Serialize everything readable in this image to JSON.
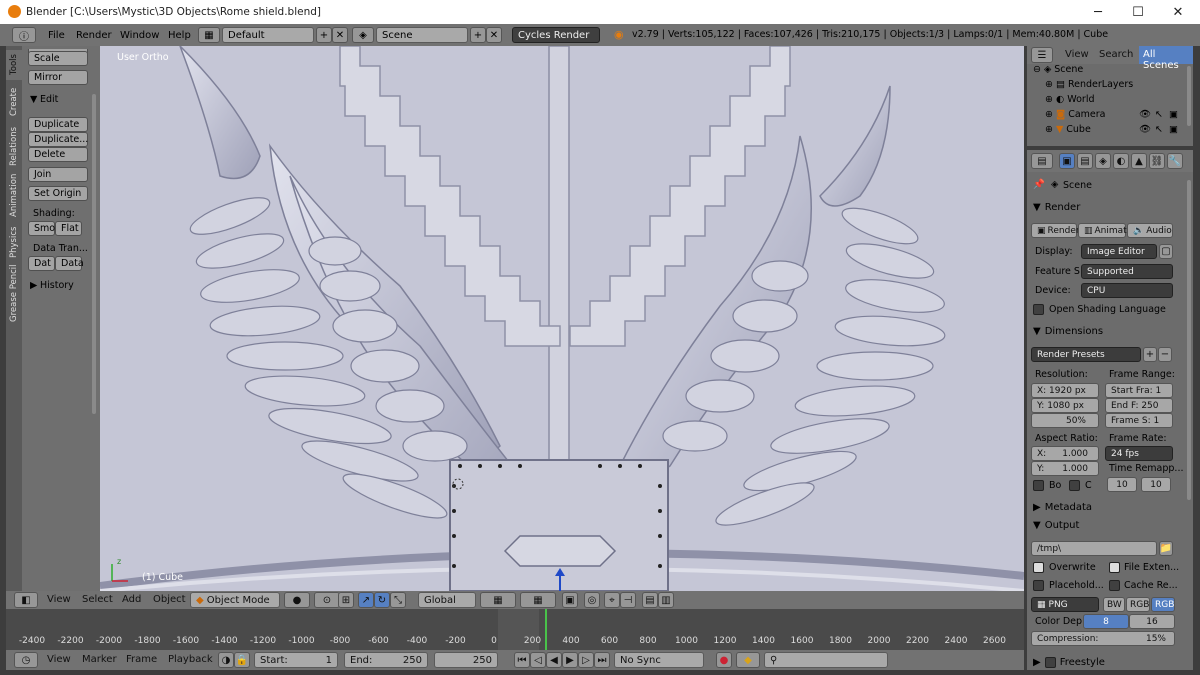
{
  "window": {
    "title": "Blender [C:\\Users\\Mystic\\3D Objects\\Rome shield.blend]",
    "minimize": "─",
    "maximize": "☐",
    "close": "✕"
  },
  "infobar": {
    "menus": [
      "File",
      "Render",
      "Window",
      "Help"
    ],
    "layout": "Default",
    "scene": "Scene",
    "engine": "Cycles Render",
    "stats": "v2.79 | Verts:105,122 | Faces:107,426 | Tris:210,175 | Objects:1/3 | Lamps:0/1 | Mem:40.80M | Cube"
  },
  "toolshelf": {
    "tabs": [
      "Tools",
      "Create",
      "Relations",
      "Animation",
      "Physics",
      "Grease Pencil"
    ],
    "scale": "Scale",
    "mirror": "Mirror",
    "edit_header": "Edit",
    "duplicate": "Duplicate",
    "duplicate_linked": "Duplicate...",
    "delete": "Delete",
    "join": "Join",
    "set_origin": "Set Origin",
    "shading_label": "Shading:",
    "smooth": "Smo",
    "flat": "Flat",
    "data_transfer_label": "Data Tran...",
    "dat1": "Dat",
    "dat2": "Data",
    "history": "History"
  },
  "viewport": {
    "view_label": "User Ortho",
    "object_label": "(1) Cube"
  },
  "viewport_header": {
    "menus": [
      "View",
      "Select",
      "Add",
      "Object"
    ],
    "mode": "Object Mode",
    "orientation": "Global"
  },
  "timeline": {
    "ticks": [
      "-2400",
      "-2200",
      "-2000",
      "-1800",
      "-1600",
      "-1400",
      "-1200",
      "-1000",
      "-800",
      "-600",
      "-400",
      "-200",
      "0",
      "200",
      "400",
      "600",
      "800",
      "1000",
      "1200",
      "1400",
      "1600",
      "1800",
      "2000",
      "2200",
      "2400",
      "2600"
    ],
    "current_frame": 250
  },
  "timeline_header": {
    "menus": [
      "View",
      "Marker",
      "Frame",
      "Playback"
    ],
    "start_label": "Start:",
    "start_value": "1",
    "end_label": "End:",
    "end_value": "250",
    "current": "250",
    "sync": "No Sync"
  },
  "outliner": {
    "tabs": [
      "View",
      "Search",
      "All Scenes"
    ],
    "items": [
      "Scene",
      "RenderLayers",
      "World",
      "Camera",
      "Cube"
    ]
  },
  "properties": {
    "context": "Scene",
    "render_header": "Render",
    "render_btn": "Render",
    "anim_btn": "Animati",
    "audio_btn": "Audio",
    "display_label": "Display:",
    "display_value": "Image Editor",
    "featureset_label": "Feature S",
    "featureset_value": "Supported",
    "device_label": "Device:",
    "device_value": "CPU",
    "osl_label": "Open Shading Language",
    "dimensions_header": "Dimensions",
    "render_presets": "Render Presets",
    "resolution_label": "Resolution:",
    "res_x": "X: 1920 px",
    "res_y": "Y: 1080 px",
    "res_pct": "50%",
    "frame_range_label": "Frame Range:",
    "start_frame": "Start Fra: 1",
    "end_frame": "End F: 250",
    "frame_step": "Frame S: 1",
    "aspect_label": "Aspect Ratio:",
    "aspect_x_label": "X:",
    "aspect_x": "1.000",
    "aspect_y_label": "Y:",
    "aspect_y": "1.000",
    "framerate_label": "Frame Rate:",
    "framerate_value": "24 fps",
    "time_remap_label": "Time Remapp...",
    "remap_old": "10",
    "remap_new": "10",
    "border_label": "Bo",
    "crop_label": "C",
    "metadata_header": "Metadata",
    "output_header": "Output",
    "output_path": "/tmp\\",
    "overwrite": "Overwrite",
    "file_ext": "File Exten...",
    "placeholders": "Placehold...",
    "cache_result": "Cache Re...",
    "format": "PNG",
    "bw": "BW",
    "rgb": "RGB",
    "rgba": "RGB",
    "color_depth_label": "Color Dep",
    "depth_8": "8",
    "depth_16": "16",
    "compression_label": "Compression:",
    "compression_value": "15%",
    "freestyle_header": "Freestyle"
  },
  "colors": {
    "accent_blue": "#5680c2",
    "viewport_bg": "#c5c6d6",
    "frame_line": "#49c24a"
  }
}
